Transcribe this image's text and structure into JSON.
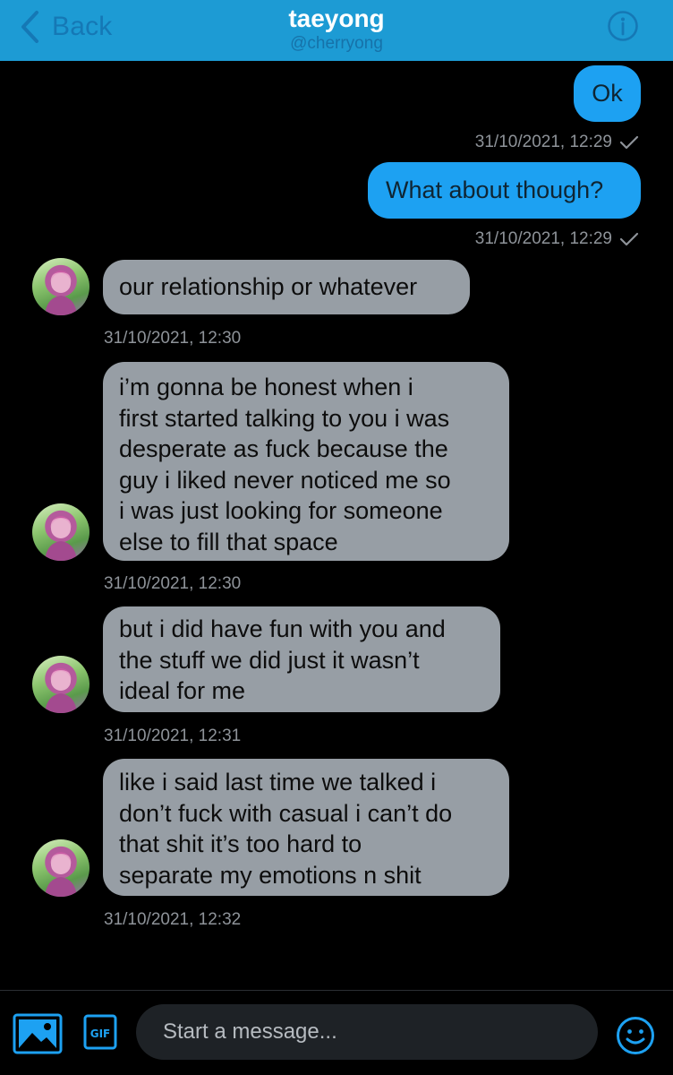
{
  "header": {
    "back_label": "Back",
    "name": "taeyong",
    "handle": "@cherryong",
    "back_icon": "chevron-left-icon",
    "info_icon": "info-icon"
  },
  "messages": [
    {
      "direction": "outgoing",
      "text": "Ok",
      "timestamp": "31/10/2021, 12:29",
      "status_icon": "check-icon"
    },
    {
      "direction": "outgoing",
      "text": "What about though?",
      "timestamp": "31/10/2021, 12:29",
      "status_icon": "check-icon"
    },
    {
      "direction": "incoming",
      "text": "our relationship or whatever",
      "timestamp": "31/10/2021, 12:30"
    },
    {
      "direction": "incoming",
      "text": "i’m gonna be honest when i\nfirst started talking to you i was\ndesperate as fuck because the\nguy i liked never noticed me so\ni was just looking for someone\nelse to fill that space",
      "timestamp": "31/10/2021, 12:30"
    },
    {
      "direction": "incoming",
      "text": "but i did have fun with you and\nthe stuff we did just it wasn’t\nideal for me",
      "timestamp": "31/10/2021, 12:31"
    },
    {
      "direction": "incoming",
      "text": "like i said last time we talked i\ndon’t fuck with casual i can’t do\nthat shit it’s too hard to\nseparate my emotions n shit",
      "timestamp": "31/10/2021, 12:32"
    }
  ],
  "composer": {
    "placeholder": "Start a message...",
    "media_icon": "image-icon",
    "gif_label": "GIF",
    "emoji_icon": "emoji-icon"
  },
  "colors": {
    "header_bg": "#1d9bd4",
    "outgoing_bubble": "#1da1f2",
    "incoming_bubble": "#979ea5",
    "background": "#000000",
    "timestamp": "#8e9399",
    "accent": "#1da1f2"
  }
}
